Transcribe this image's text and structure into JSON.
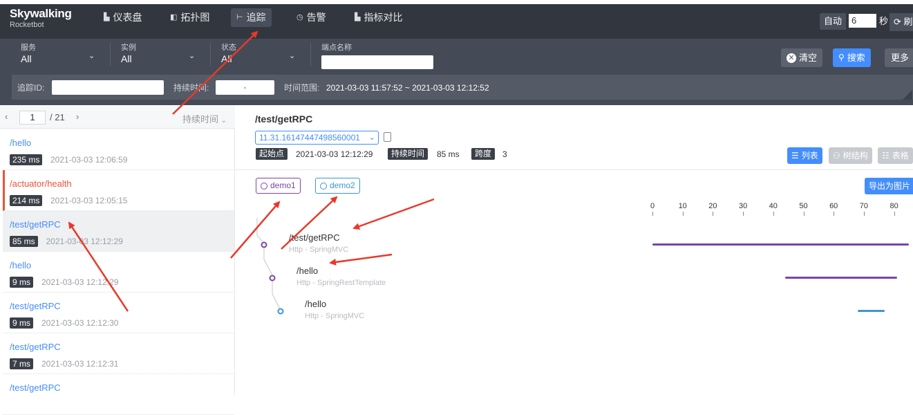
{
  "logo": {
    "line1": "Skywalking",
    "line2": "Rocketbot"
  },
  "nav": [
    {
      "label": "仪表盘",
      "icon": "chart-icon"
    },
    {
      "label": "拓扑图",
      "icon": "topology-icon"
    },
    {
      "label": "追踪",
      "icon": "trace-icon"
    },
    {
      "label": "告警",
      "icon": "alarm-icon"
    },
    {
      "label": "指标对比",
      "icon": "compare-icon"
    }
  ],
  "topright": {
    "auto_label": "自动",
    "auto_value": "6",
    "sec_label": "秒",
    "refresh_label": "刷"
  },
  "filters": {
    "service": {
      "label": "服务",
      "value": "All"
    },
    "instance": {
      "label": "实例",
      "value": "All"
    },
    "status": {
      "label": "状态",
      "value": "All"
    },
    "endpoint": {
      "label": "端点名称",
      "value": ""
    },
    "clear_label": "清空",
    "search_label": "搜索",
    "more_label": "更多",
    "trace_id_label": "追踪ID:",
    "duration_label": "持续时间:",
    "duration_sep": "-",
    "time_range_label": "时间范围:",
    "time_range_value": "2021-03-03 11:57:52 ~ 2021-03-03 12:12:52"
  },
  "pager": {
    "current": "1",
    "total": "/ 21",
    "sort_label": "持续时间"
  },
  "traces": [
    {
      "title": "/hello",
      "duration": "235 ms",
      "time": "2021-03-03 12:06:59",
      "error": false,
      "selected": false
    },
    {
      "title": "/actuator/health",
      "duration": "214 ms",
      "time": "2021-03-03 12:05:15",
      "error": true,
      "selected": false
    },
    {
      "title": "/test/getRPC",
      "duration": "85 ms",
      "time": "2021-03-03 12:12:29",
      "error": false,
      "selected": true
    },
    {
      "title": "/hello",
      "duration": "9 ms",
      "time": "2021-03-03 12:12:29",
      "error": false,
      "selected": false
    },
    {
      "title": "/test/getRPC",
      "duration": "9 ms",
      "time": "2021-03-03 12:12:30",
      "error": false,
      "selected": false
    },
    {
      "title": "/test/getRPC",
      "duration": "7 ms",
      "time": "2021-03-03 12:12:31",
      "error": false,
      "selected": false
    },
    {
      "title": "/test/getRPC",
      "duration": "",
      "time": "",
      "error": false,
      "selected": false
    }
  ],
  "detail": {
    "title": "/test/getRPC",
    "trace_id": "11.31.16147447498560001",
    "start_label": "起始点",
    "start_value": "2021-03-03 12:12:29",
    "duration_label": "持续时间",
    "duration_value": "85 ms",
    "span_label": "跨度",
    "span_value": "3",
    "view_list": "列表",
    "view_tree": "树结构",
    "view_table": "表格",
    "export_label": "导出为图片",
    "services": [
      {
        "name": "demo1",
        "color": "#7a44a8"
      },
      {
        "name": "demo2",
        "color": "#3a95d8"
      }
    ],
    "axis_ticks": [
      "0",
      "10",
      "20",
      "30",
      "40",
      "50",
      "60",
      "70",
      "80"
    ],
    "spans": [
      {
        "title": "/test/getRPC",
        "sub": "Http - SpringMVC",
        "color": "#7a44a8",
        "start": 0,
        "end": 85
      },
      {
        "title": "/hello",
        "sub": "Http - SpringRestTemplate",
        "color": "#7a44a8",
        "start": 44,
        "end": 81
      },
      {
        "title": "/hello",
        "sub": "Http - SpringMVC",
        "color": "#3a95d8",
        "start": 68,
        "end": 77
      }
    ]
  }
}
